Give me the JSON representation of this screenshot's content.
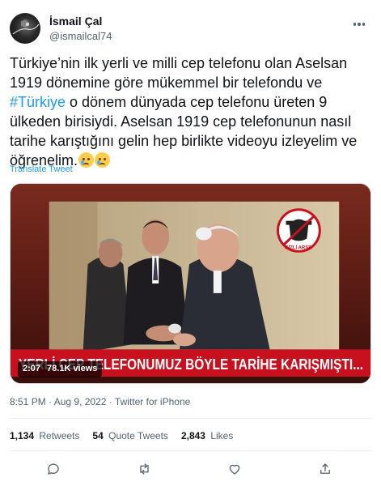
{
  "author": {
    "name": "İsmail Çal",
    "handle": "@ismailcal74",
    "avatar_icon": "avatar-image"
  },
  "tweet": {
    "text_part1": "Türkiye’nin ilk yerli ve milli cep telefonu olan Aselsan 1919 dönemine göre mükemmel bir telefondu ve ",
    "hashtag": "#Türkiye",
    "text_part2": " o dönem dünyada cep telefonu üreten 9 ülkeden birisiydi. Aselsan 1919 cep telefonunun nasıl tarihe karıştığını gelin hep birlikte videoyu izleyelim ve öğrenelim.",
    "emojis": [
      "crying-face-emoji",
      "crying-face-emoji"
    ],
    "translate_label": "Translate Tweet"
  },
  "video": {
    "caption_banner": "YERLİ CEP TELEFONUMUZ BÖYLE TARİHE KARIŞMIŞTI...",
    "duration": "2:07",
    "views": "78.1K views",
    "watermark": "GİZLİ ARŞİV",
    "banner_color": "#c8101e"
  },
  "meta": {
    "time": "8:51 PM",
    "separator": "·",
    "date": "Aug 9, 2022",
    "source": "Twitter for iPhone"
  },
  "stats": {
    "retweets_count": "1,134",
    "retweets_label": "Retweets",
    "quotes_count": "54",
    "quotes_label": "Quote Tweets",
    "likes_count": "2,843",
    "likes_label": "Likes"
  },
  "actions": [
    "reply-icon",
    "retweet-icon",
    "like-icon",
    "share-icon"
  ],
  "colors": {
    "accent": "#1d9bf0",
    "text": "#0f1419",
    "secondary": "#536471"
  }
}
